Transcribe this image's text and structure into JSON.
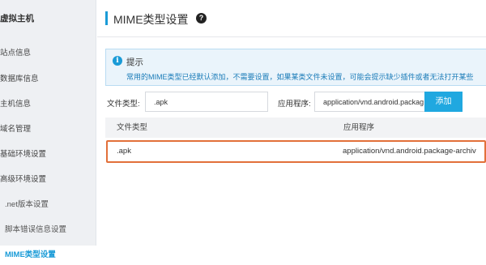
{
  "sidebar": {
    "title": "虚拟主机",
    "items": [
      {
        "label": "站点信息"
      },
      {
        "label": "数据库信息"
      },
      {
        "label": "主机信息"
      },
      {
        "label": "域名管理"
      },
      {
        "label": "基础环境设置"
      },
      {
        "label": "高级环境设置"
      },
      {
        "label": ".net版本设置"
      },
      {
        "label": "脚本错误信息设置"
      },
      {
        "label": "MIME类型设置"
      }
    ],
    "active_item": "MIME类型设置"
  },
  "header": {
    "title": "MIME类型设置",
    "help_icon": "?"
  },
  "notice": {
    "icon": "i",
    "title": "提示",
    "text": "常用的MIME类型已经默认添加，不需要设置，如果某类文件未设置，可能会提示缺少插件或者无法打开某些"
  },
  "form": {
    "file_type_label": "文件类型:",
    "file_type_value": ".apk",
    "app_label": "应用程序:",
    "app_value": "application/vnd.android.packag",
    "add_label": "添加"
  },
  "table": {
    "headers": [
      "文件类型",
      "应用程序"
    ],
    "rows": [
      {
        "file_type": ".apk",
        "application": "application/vnd.android.package-archiv"
      }
    ]
  },
  "colors": {
    "accent": "#1a9bd7",
    "button": "#20a8e0",
    "highlight_border": "#e2703a",
    "sidebar_bg": "#eef0f3"
  }
}
